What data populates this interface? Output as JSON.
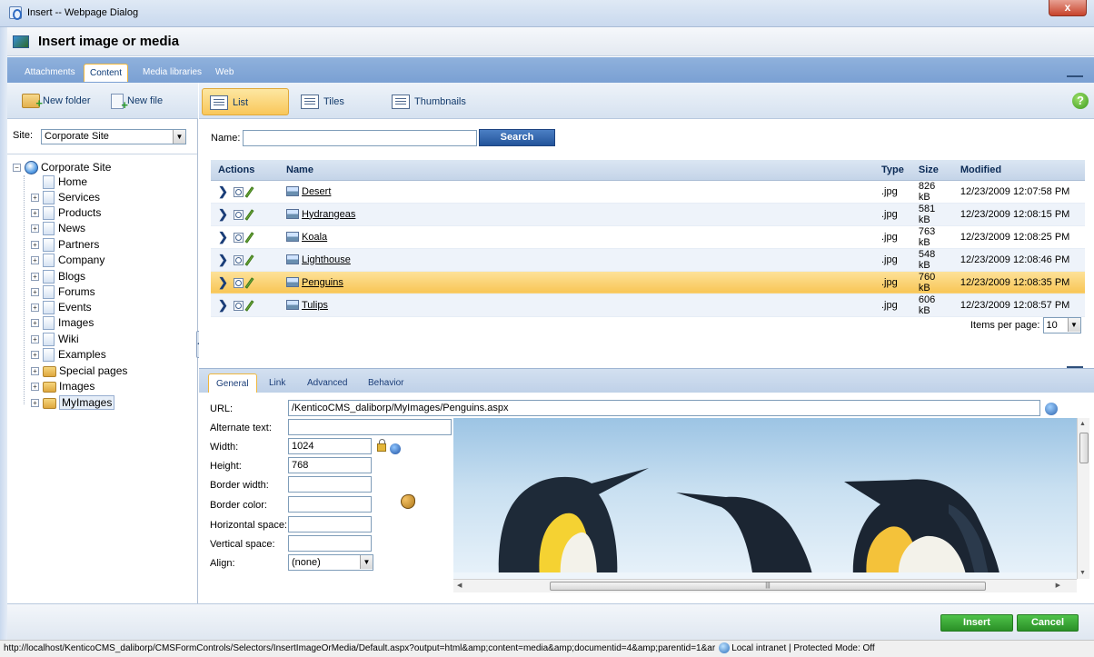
{
  "window": {
    "title": "Insert -- Webpage Dialog",
    "close_label": "x"
  },
  "dialog": {
    "title": "Insert image or media"
  },
  "tabs": [
    {
      "label": "Attachments"
    },
    {
      "label": "Content"
    },
    {
      "label": "Media libraries"
    },
    {
      "label": "Web"
    }
  ],
  "left_toolbar": {
    "new_folder": "New folder",
    "new_file": "New file"
  },
  "site": {
    "label": "Site:",
    "value": "Corporate Site"
  },
  "tree": {
    "root": "Corporate Site",
    "items": [
      {
        "label": "Home"
      },
      {
        "label": "Services"
      },
      {
        "label": "Products"
      },
      {
        "label": "News"
      },
      {
        "label": "Partners"
      },
      {
        "label": "Company"
      },
      {
        "label": "Blogs"
      },
      {
        "label": "Forums"
      },
      {
        "label": "Events"
      },
      {
        "label": "Images"
      },
      {
        "label": "Wiki"
      },
      {
        "label": "Examples"
      },
      {
        "label": "Special pages"
      },
      {
        "label": "Images"
      },
      {
        "label": "MyImages"
      }
    ]
  },
  "views": {
    "list": "List",
    "tiles": "Tiles",
    "thumbnails": "Thumbnails"
  },
  "help_label": "?",
  "search": {
    "name_label": "Name:",
    "button": "Search",
    "value": ""
  },
  "table": {
    "headers": {
      "actions": "Actions",
      "name": "Name",
      "type": "Type",
      "size": "Size",
      "modified": "Modified"
    },
    "rows": [
      {
        "name": "Desert",
        "type": ".jpg",
        "size": "826 kB",
        "modified": "12/23/2009 12:07:58 PM"
      },
      {
        "name": "Hydrangeas",
        "type": ".jpg",
        "size": "581 kB",
        "modified": "12/23/2009 12:08:15 PM"
      },
      {
        "name": "Koala",
        "type": ".jpg",
        "size": "763 kB",
        "modified": "12/23/2009 12:08:25 PM"
      },
      {
        "name": "Lighthouse",
        "type": ".jpg",
        "size": "548 kB",
        "modified": "12/23/2009 12:08:46 PM"
      },
      {
        "name": "Penguins",
        "type": ".jpg",
        "size": "760 kB",
        "modified": "12/23/2009 12:08:35 PM"
      },
      {
        "name": "Tulips",
        "type": ".jpg",
        "size": "606 kB",
        "modified": "12/23/2009 12:08:57 PM"
      }
    ]
  },
  "pager": {
    "label": "Items per page:",
    "value": "10"
  },
  "prop_tabs": [
    {
      "label": "General"
    },
    {
      "label": "Link"
    },
    {
      "label": "Advanced"
    },
    {
      "label": "Behavior"
    }
  ],
  "props": {
    "url_label": "URL:",
    "url_value": "/KenticoCMS_daliborp/MyImages/Penguins.aspx",
    "alt_label": "Alternate text:",
    "alt_value": "",
    "width_label": "Width:",
    "width_value": "1024",
    "height_label": "Height:",
    "height_value": "768",
    "border_width_label": "Border width:",
    "border_color_label": "Border color:",
    "hspace_label": "Horizontal space:",
    "vspace_label": "Vertical space:",
    "align_label": "Align:",
    "align_value": "(none)"
  },
  "footer": {
    "insert": "Insert",
    "cancel": "Cancel"
  },
  "statusbar": {
    "url": "http://localhost/KenticoCMS_daliborp/CMSFormControls/Selectors/InsertImageOrMedia/Default.aspx?output=html&amp;content=media&amp;documentid=4&amp;parentid=1&ar",
    "zone": "Local intranet | Protected Mode: Off"
  },
  "colors": {
    "accent": "#f9c75a",
    "header_blue": "#7aa0d3",
    "button_green": "#2a8f26",
    "search_blue": "#23549a"
  }
}
